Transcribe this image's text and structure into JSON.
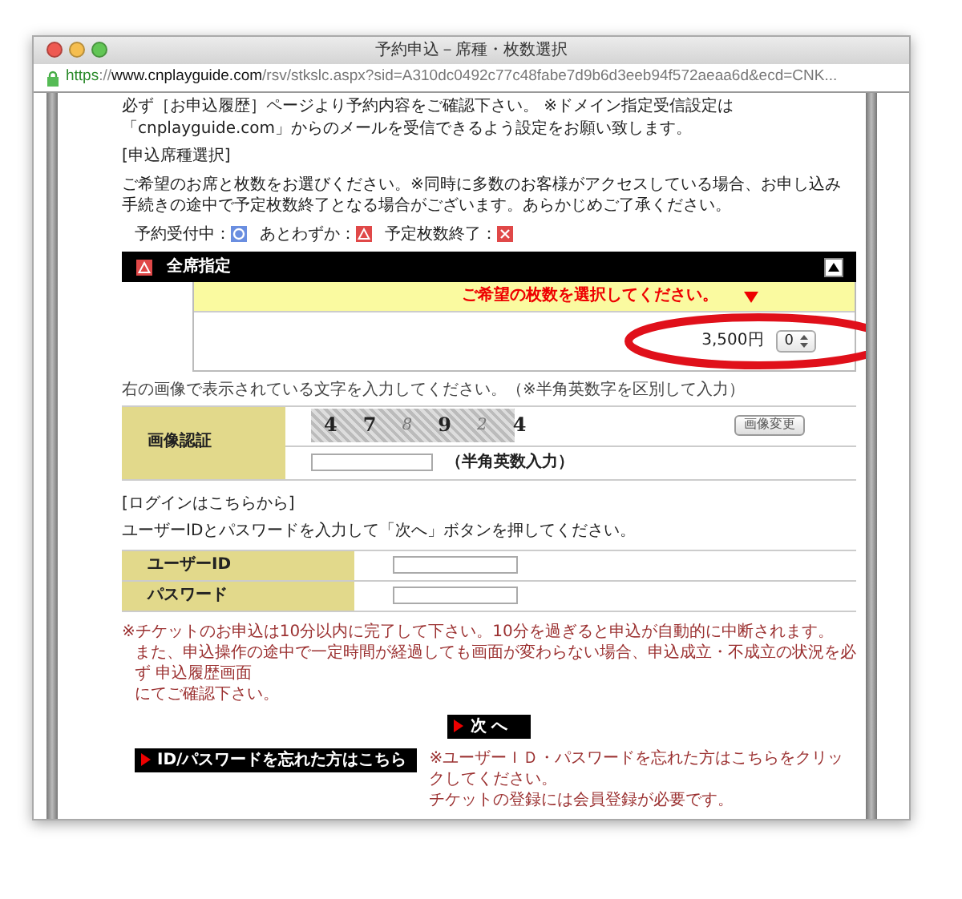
{
  "window": {
    "title": "予約申込－席種・枚数選択"
  },
  "url": [
    {
      "kind": "scheme",
      "text": "https"
    },
    {
      "kind": "sep",
      "text": "://"
    },
    {
      "kind": "host",
      "text": "www.cnplayguide.com"
    },
    {
      "kind": "path",
      "text": "/rsv/stkslc.aspx?sid=A310dc0492c77c48fabe7d9b6d3eeb94f572aeaa6d&ecd=CNK..."
    }
  ],
  "intro": [
    "必ず［お申込履歴］ページより予約内容をご確認下さい。 ※ドメイン指定受信設定は「cnplayguide.com」からのメールを受信できるよう設定をお願い致します。"
  ],
  "seat_section": {
    "heading": "[申込席種選択]",
    "description": "ご希望のお席と枚数をお選びください。※同時に多数のお客様がアクセスしている場合、お申し込み手続きの途中で予定枚数終了となる場合がございます。あらかじめご了承ください。",
    "legend": [
      {
        "label": "予約受付中：",
        "kind": "available"
      },
      {
        "label": "あとわずか：",
        "kind": "few"
      },
      {
        "label": "予定枚数終了：",
        "kind": "soldout"
      }
    ],
    "seat_types": [
      {
        "name": "全席指定",
        "kind": "few",
        "expanded": true,
        "prompt": "ご希望の枚数を選択してください。",
        "price": "3,500円",
        "quantity": "0"
      }
    ]
  },
  "captcha": {
    "instruction": "右の画像で表示されている文字を入力してください。（※半角英数字を区別して入力）",
    "label": "画像認証",
    "characters": [
      "4",
      "7",
      "8",
      "9",
      "2",
      "4"
    ],
    "change_button": "画像変更",
    "hint": "（半角英数入力）"
  },
  "login": {
    "heading": "[ログインはこちらから]",
    "instruction": "ユーザーIDとパスワードを入力して「次へ」ボタンを押してください。",
    "fields": [
      {
        "label": "ユーザーID"
      },
      {
        "label": "パスワード"
      }
    ]
  },
  "notes": [
    "※チケットのお申込は10分以内に完了して下さい。10分を過ぎると申込が自動的に中断されます。",
    "また、申込操作の途中で一定時間が経過しても画面が変わらない場合、申込成立・不成立の状況を必ず 申込履歴画面",
    "にてご確認下さい。"
  ],
  "next_button": "次 へ",
  "forgot": {
    "button": "ID/パスワードを忘れた方はこちら",
    "notes": [
      "※ユーザーＩＤ・パスワードを忘れた方はこちらをクリックしてください。",
      "チケットの登録には会員登録が必要です。"
    ]
  }
}
